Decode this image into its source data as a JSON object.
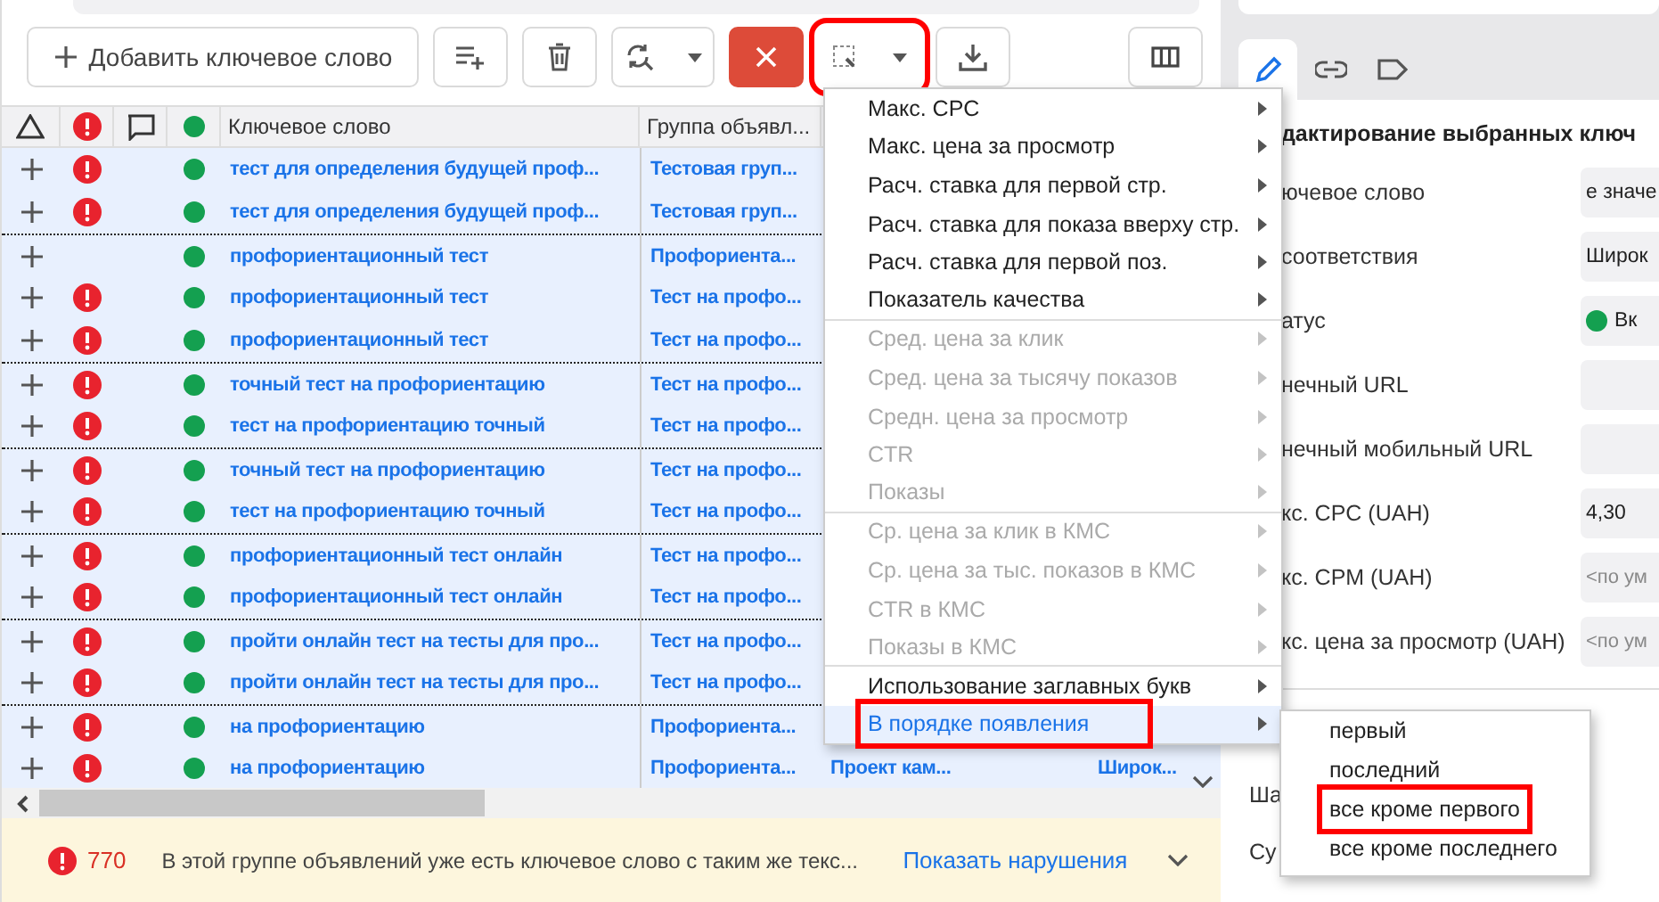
{
  "toolbar": {
    "add_button": "Добавить ключевое слово",
    "buttons": [
      {
        "kind": "add-list",
        "highlighted": false
      },
      {
        "kind": "delete",
        "highlighted": false
      },
      {
        "kind": "search-replace",
        "split": true,
        "highlighted": false
      },
      {
        "kind": "close",
        "highlighted": false
      },
      {
        "kind": "select",
        "split": true,
        "highlighted": true
      },
      {
        "kind": "download",
        "highlighted": false
      }
    ],
    "columns_button": {
      "kind": "columns"
    }
  },
  "table": {
    "columns": [
      {
        "kind": "triangle"
      },
      {
        "kind": "error"
      },
      {
        "kind": "comment"
      },
      {
        "kind": "status"
      },
      {
        "kind": "text",
        "label": "Ключевое слово"
      },
      {
        "kind": "text",
        "label": "Группа объявл..."
      }
    ],
    "rows": [
      {
        "keyword": "тест для определения будущей проф...",
        "ad_group": "Тестовая груп...",
        "error": true,
        "new_group": false
      },
      {
        "keyword": "тест для определения будущей проф...",
        "ad_group": "Тестовая груп...",
        "error": true,
        "new_group": false
      },
      {
        "keyword": "профориентационный тест",
        "ad_group": "Профориента...",
        "error": false,
        "new_group": true
      },
      {
        "keyword": "профориентационный тест",
        "ad_group": "Тест на профо...",
        "error": true,
        "new_group": false
      },
      {
        "keyword": "профориентационный тест",
        "ad_group": "Тест на профо...",
        "error": true,
        "new_group": false
      },
      {
        "keyword": "точный тест на профориентацию",
        "ad_group": "Тест на профо...",
        "error": true,
        "new_group": true
      },
      {
        "keyword": "тест на профориентацию точный",
        "ad_group": "Тест на профо...",
        "error": true,
        "new_group": false
      },
      {
        "keyword": "точный тест на профориентацию",
        "ad_group": "Тест на профо...",
        "error": true,
        "new_group": true
      },
      {
        "keyword": "тест на профориентацию точный",
        "ad_group": "Тест на профо...",
        "error": true,
        "new_group": false
      },
      {
        "keyword": "профориентационный тест онлайн",
        "ad_group": "Тест на профо...",
        "error": true,
        "new_group": true
      },
      {
        "keyword": "профориентационный тест онлайн",
        "ad_group": "Тест на профо...",
        "error": true,
        "new_group": false
      },
      {
        "keyword": "пройти онлайн тест на тесты для про...",
        "ad_group": "Тест на профо...",
        "error": true,
        "new_group": true
      },
      {
        "keyword": "пройти онлайн тест на тесты для про...",
        "ad_group": "Тест на профо...",
        "error": true,
        "new_group": false
      },
      {
        "keyword": "на профориентацию",
        "ad_group": "Профориента...",
        "error": true,
        "new_group": true
      },
      {
        "keyword": "на профориентацию",
        "ad_group": "Профориента...",
        "error": true,
        "new_group": false,
        "campaign": "Проект кам...",
        "match_type": "Широк..."
      }
    ]
  },
  "menu": {
    "items": [
      {
        "label": "Макс. CPC",
        "disabled": false,
        "selected": false,
        "separator_after": false
      },
      {
        "label": "Макс. цена за просмотр",
        "disabled": false,
        "selected": false,
        "separator_after": false
      },
      {
        "label": "Расч. ставка для первой стр.",
        "disabled": false,
        "selected": false,
        "separator_after": false
      },
      {
        "label": "Расч. ставка для показа вверху стр.",
        "disabled": false,
        "selected": false,
        "separator_after": false
      },
      {
        "label": "Расч. ставка для первой поз.",
        "disabled": false,
        "selected": false,
        "separator_after": false
      },
      {
        "label": "Показатель качества",
        "disabled": false,
        "selected": false,
        "separator_after": true
      },
      {
        "label": "Сред. цена за клик",
        "disabled": true,
        "selected": false,
        "separator_after": false
      },
      {
        "label": "Сред. цена за тысячу показов",
        "disabled": true,
        "selected": false,
        "separator_after": false
      },
      {
        "label": "Средн. цена за просмотр",
        "disabled": true,
        "selected": false,
        "separator_after": false
      },
      {
        "label": "CTR",
        "disabled": true,
        "selected": false,
        "separator_after": false
      },
      {
        "label": "Показы",
        "disabled": true,
        "selected": false,
        "separator_after": true
      },
      {
        "label": "Ср. цена за клик в КМС",
        "disabled": true,
        "selected": false,
        "separator_after": false
      },
      {
        "label": "Ср. цена за тыс. показов в КМС",
        "disabled": true,
        "selected": false,
        "separator_after": false
      },
      {
        "label": "CTR в КМС",
        "disabled": true,
        "selected": false,
        "separator_after": false
      },
      {
        "label": "Показы в КМС",
        "disabled": true,
        "selected": false,
        "separator_after": true
      },
      {
        "label": "Использование заглавных букв",
        "disabled": false,
        "selected": false,
        "separator_after": false
      },
      {
        "label": "В порядке появления",
        "disabled": false,
        "selected": true,
        "separator_after": false
      }
    ],
    "submenu": [
      {
        "label": "первый",
        "selected": false
      },
      {
        "label": "последний",
        "selected": false
      },
      {
        "label": "все кроме первого",
        "selected": true
      },
      {
        "label": "все кроме последнего",
        "selected": false
      }
    ]
  },
  "side_panel": {
    "tabs": [
      {
        "kind": "edit",
        "selected": true
      },
      {
        "kind": "link",
        "selected": false
      },
      {
        "kind": "label",
        "selected": false
      }
    ],
    "heading": "дактирование выбранных ключ",
    "fields": [
      {
        "label": "ючевое слово",
        "value": "е значе"
      },
      {
        "label": "соответствия",
        "value": "Широк"
      },
      {
        "label": "атус",
        "value": "Вк",
        "status": true
      },
      {
        "label": "нечный URL"
      },
      {
        "label": "нечный мобильный URL"
      },
      {
        "label": "кс. CPC (UAH)",
        "value": "4,30"
      },
      {
        "label": "кс. CPM (UAH)",
        "placeholder": "<по ум"
      },
      {
        "label": "кс. цена за просмотр (UAH)",
        "placeholder": "<по ум"
      }
    ],
    "bottom_labels": [
      "Ша",
      "Су"
    ]
  },
  "footer": {
    "count": "770",
    "message": "В этой группе объявлений уже есть ключевое слово с таким же текс...",
    "link": "Показать нарушения"
  }
}
